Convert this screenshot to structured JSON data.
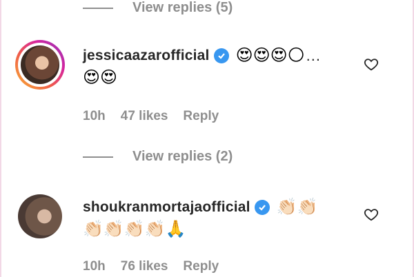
{
  "top_view_replies": {
    "label": "View replies (5)"
  },
  "comments": [
    {
      "username": "jessicaazarofficial",
      "line1": "😍😍😍🌕",
      "more": "...",
      "line2": "😍😍",
      "time": "10h",
      "likes": "47 likes",
      "reply": "Reply",
      "view_replies": "View replies (2)"
    },
    {
      "username": "shoukranmortajaofficial",
      "line1": "👏🏻👏🏻",
      "line2": "👏🏻👏🏻👏🏻👏🏻🙏",
      "time": "10h",
      "likes": "76 likes",
      "reply": "Reply"
    }
  ],
  "icons": {
    "verified": "verified-badge-icon",
    "like": "heart-outline-icon"
  },
  "colors": {
    "verified": "#3897f0",
    "meta_text": "#8e8e8e",
    "username": "#262626"
  }
}
